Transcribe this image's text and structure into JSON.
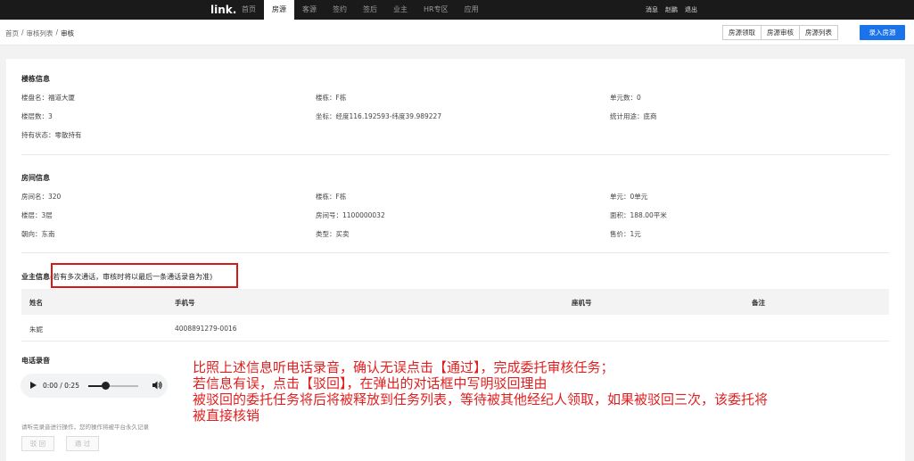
{
  "topbar": {
    "logo": "link.",
    "nav": [
      "首页",
      "房源",
      "客源",
      "签约",
      "签后",
      "业主",
      "HR专区",
      "应用"
    ],
    "active_index": 1,
    "right": [
      "消息",
      "赵鹏",
      "退出"
    ]
  },
  "breadcrumb": [
    "首页",
    "/",
    "审核列表",
    "/",
    "审核"
  ],
  "buttons": {
    "claim": "房源领取",
    "review": "房源审核",
    "list": "房源列表",
    "enter": "录入房源"
  },
  "building": {
    "title": "楼栋信息",
    "estate": "楼盘名：福道大厦",
    "building": "楼栋：F栋",
    "units": "单元数：0",
    "floors": "楼层数：3",
    "coords": "坐标：经度116.192593-纬度39.989227",
    "usage": "统计用途：底商",
    "holding": "持有状态：零散持有"
  },
  "room": {
    "title": "房间信息",
    "name": "房间名：320",
    "building": "楼栋：F栋",
    "unit": "单元：0单元",
    "floor": "楼层：3层",
    "room_no": "房间号：1100000032",
    "area": "面积：188.00平米",
    "orientation": "朝向：东南",
    "type": "类型：买卖",
    "price": "售价：1元"
  },
  "owner": {
    "title": "业主信息",
    "note": "(若有多次通话，审核时将以最后一条通话录音为准)",
    "headers": [
      "姓名",
      "手机号",
      "座机号",
      "备注"
    ],
    "rows": [
      [
        "朱妮",
        "4008891279-0016",
        "",
        ""
      ]
    ]
  },
  "recording": {
    "title": "电话录音",
    "time": "0:00 / 0:25",
    "progress": 0.25,
    "hint": "请听完录音进行操作，您的操作将被平台永久记录",
    "reject": "驳 回",
    "pass": "通 过"
  },
  "annotation": [
    "比照上述信息听电话录音，确认无误点击【通过】，完成委托审核任务；",
    "若信息有误，点击【驳回】，在弹出的对话框中写明驳回理由",
    "被驳回的委托任务将后将被释放到任务列表，等待被其他经纪人领取，如果被驳回三次，该委托将",
    "被直接核销"
  ],
  "colors": {
    "primary": "#1a73e8",
    "highlight": "#d71818",
    "annotation": "#e02020",
    "topbar": "#1a1a1a"
  }
}
